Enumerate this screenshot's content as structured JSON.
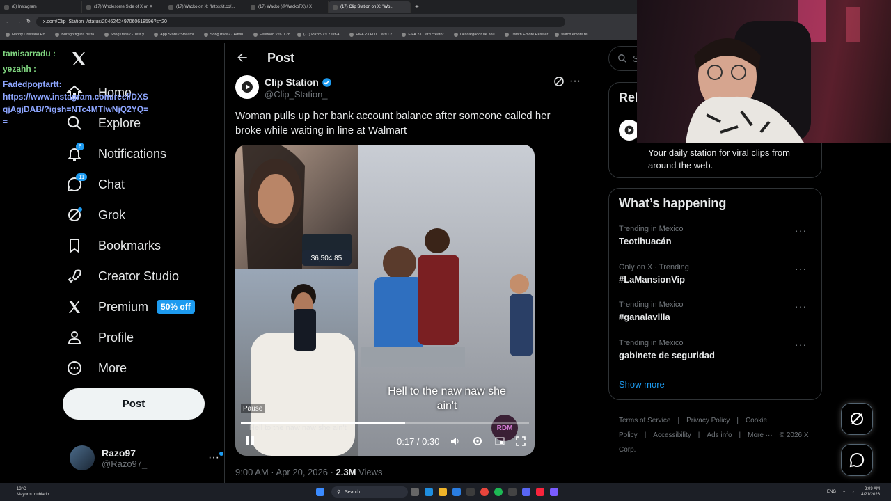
{
  "browser": {
    "tabs": [
      {
        "label": "(8) Instagram",
        "active": false
      },
      {
        "label": "(17) Wholesome Side of X on X",
        "active": false
      },
      {
        "label": "(17) Wacko on X: \"https://t.co/...",
        "active": false
      },
      {
        "label": "(17) Wacko (@WackoFX) / X",
        "active": false
      },
      {
        "label": "(17) Clip Station on X: \"Wo...",
        "active": true
      }
    ],
    "url": "x.com/Clip_Station_/status/2046242497060618596?s=20",
    "bookmarks": [
      "Happy Cristiano Ro...",
      "Burago figura de ta...",
      "SongTrivia2 - Test y...",
      "App Store / Streami...",
      "SongTrivia2 - Advin...",
      "Feletoob v26.0.28",
      "(77) Razo97's Zest-A...",
      "FIFA 23 FUT Card Cr...",
      "FIFA 23 Card creator...",
      "Descargador de You...",
      "Twitch Emote Resizer",
      "twitch emote re..."
    ]
  },
  "chat": {
    "lines": [
      {
        "user": "tamisarradu :",
        "color": "#7fd47f",
        "text": ""
      },
      {
        "user": "yezahh :",
        "color": "#7fd47f",
        "text": ""
      },
      {
        "user": "Fadedpoptartt:",
        "color": "#8ea6ff",
        "text": "https://www.instagram.com/reel/DXSqjAgjDAB/?igsh=NTc4MTIwNjQ2YQ=="
      }
    ]
  },
  "nav": {
    "items": [
      {
        "label": "Home",
        "icon": "home-icon"
      },
      {
        "label": "Explore",
        "icon": "search-icon"
      },
      {
        "label": "Notifications",
        "icon": "bell-icon",
        "badge": "6"
      },
      {
        "label": "Chat",
        "icon": "chat-icon",
        "badge": "11"
      },
      {
        "label": "Grok",
        "icon": "grok-icon"
      },
      {
        "label": "Bookmarks",
        "icon": "bookmark-icon"
      },
      {
        "label": "Creator Studio",
        "icon": "rocket-icon"
      },
      {
        "label": "Premium",
        "icon": "x-logo-icon",
        "pill": "50% off"
      },
      {
        "label": "Profile",
        "icon": "person-icon"
      },
      {
        "label": "More",
        "icon": "more-circle-icon"
      }
    ],
    "post_button": "Post",
    "account": {
      "name": "Razo97",
      "handle": "@Razo97_"
    }
  },
  "main": {
    "header_title": "Post",
    "author": {
      "name": "Clip Station",
      "handle": "@Clip_Station_",
      "verified": true
    },
    "tweet_text": "Woman pulls up her bank account balance after someone called her broke while waiting in line at Walmart",
    "video": {
      "caption": "Hell to the naw naw she ain't",
      "caption_ghost": "Hell to the naw naw she ain't",
      "phone_balance": "$6,504.85",
      "pause_tooltip": "Pause",
      "current_time": "0:17",
      "duration": "0:30",
      "progress": 0.57,
      "watermark": "RDM"
    },
    "timestamp": "9:00 AM · Apr 20, 2026 · ",
    "views_count": "2.3M",
    "views_label": " Views"
  },
  "right": {
    "search_placeholder": "Se",
    "relevant_title": "Rel",
    "relevant_bio": "Your daily station for viral clips from around the web.",
    "trends_title": "What’s happening",
    "trends": [
      {
        "context": "Trending in Mexico",
        "topic": "Teotihuacán"
      },
      {
        "context": "Only on X · Trending",
        "topic": "#LaMansionVip"
      },
      {
        "context": "Trending in Mexico",
        "topic": "#ganalavilla"
      },
      {
        "context": "Trending in Mexico",
        "topic": "gabinete de seguridad"
      }
    ],
    "show_more": "Show more",
    "footer_links": [
      "Terms of Service",
      "|",
      "Privacy Policy",
      "|",
      "Cookie Policy",
      "|",
      "Accessibility",
      "|",
      "Ads info",
      "|",
      "More ···",
      "© 2026 X Corp."
    ]
  },
  "taskbar": {
    "weather_temp": "13°C",
    "weather_desc": "Mayorm. nublado",
    "search_label": "Search",
    "lang": "ENG",
    "time": "3:09 AM",
    "date": "4/21/2026"
  },
  "colors": {
    "accent": "#1d9bf0",
    "background": "#000000",
    "border": "#2f3336",
    "muted": "#71767b"
  }
}
